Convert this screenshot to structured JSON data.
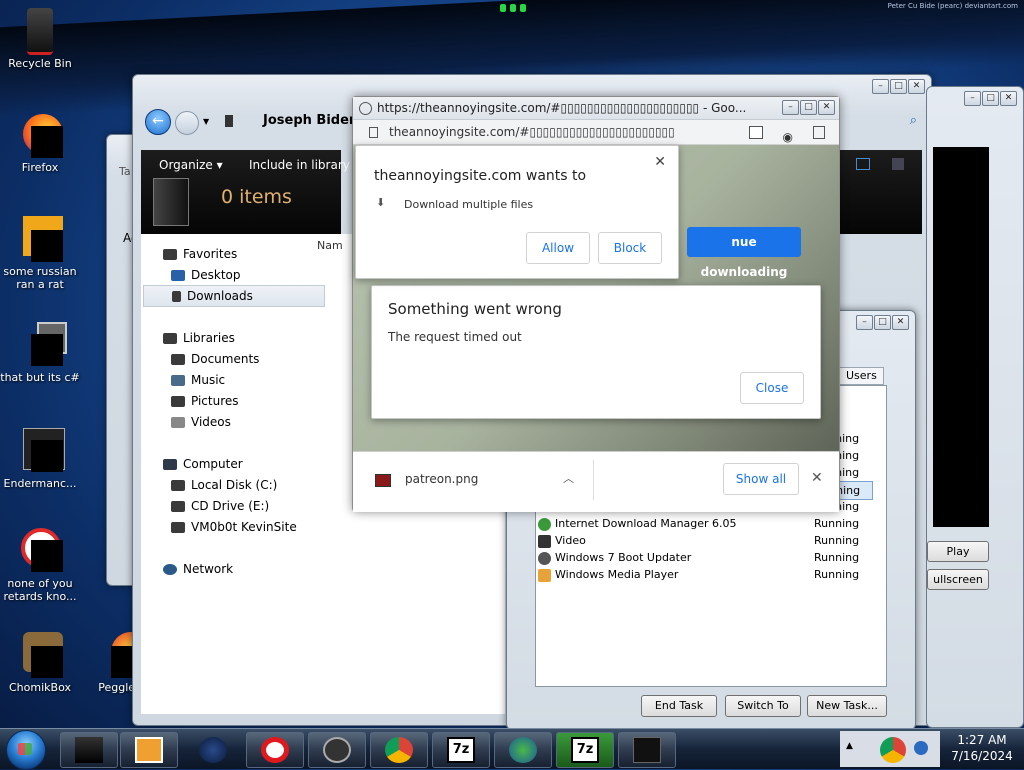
{
  "desktop": {
    "watermark": "Peter Cu Bide (pearc) deviantart.com",
    "icons": [
      {
        "label": "Recycle Bin"
      },
      {
        "label": "Firefox"
      },
      {
        "label": "some russian ran a rat"
      },
      {
        "label": "that but its c#"
      },
      {
        "label": "Endermanc..."
      },
      {
        "label": "none of you retards kno..."
      },
      {
        "label": "ChomikBox"
      },
      {
        "label": "Peggle De"
      }
    ]
  },
  "explorer": {
    "breadcrumb": "Joseph Biden",
    "organize_label": "Organize",
    "include_label": "Include in library",
    "items_count": "0 items",
    "name_col": "Nam",
    "tab_label": "Ta",
    "side_label": "Ac",
    "nav": {
      "favorites": "Favorites",
      "desktop": "Desktop",
      "downloads": "Downloads",
      "libraries": "Libraries",
      "documents": "Documents",
      "music": "Music",
      "pictures": "Pictures",
      "videos": "Videos",
      "computer": "Computer",
      "local_disk": "Local Disk (C:)",
      "cd_drive": "CD Drive (E:)",
      "vm": "VM0b0t KevinSite",
      "network": "Network"
    }
  },
  "chrome": {
    "title": "https://theannoyingsite.com/#▯▯▯▯▯▯▯▯▯▯▯▯▯▯▯▯▯▯▯▯▯ - Goo...",
    "url": "theannoyingsite.com/#▯▯▯▯▯▯▯▯▯▯▯▯▯▯▯▯▯▯▯▯▯▯",
    "permission": {
      "title": "theannoyingsite.com wants to",
      "request": "Download multiple files",
      "allow": "Allow",
      "block": "Block"
    },
    "continue_label": "nue downloading",
    "error": {
      "title": "Something went wrong",
      "message": "The request timed out",
      "close": "Close"
    },
    "download_bar": {
      "file": "patreon.png",
      "show_all": "Show all"
    }
  },
  "task_manager": {
    "users_tab": "Users",
    "status_col": "s",
    "rows": [
      {
        "name": "",
        "status": "Running"
      },
      {
        "name": "",
        "status": "Running"
      },
      {
        "name": "",
        "status": "Running"
      },
      {
        "name": "",
        "status": "Running"
      },
      {
        "name": "",
        "status": "Running"
      },
      {
        "name": "Internet Download Manager 6.05",
        "status": "Running"
      },
      {
        "name": "Video",
        "status": "Running"
      },
      {
        "name": "Windows 7 Boot Updater",
        "status": "Running"
      },
      {
        "name": "Windows Media Player",
        "status": "Running"
      }
    ],
    "end_task": "End Task",
    "switch_to": "Switch To",
    "new_task": "New Task..."
  },
  "media_player": {
    "play": "Play",
    "fullscreen": "ullscreen"
  },
  "taskbar": {
    "time": "1:27 AM",
    "date": "7/16/2024",
    "items": [
      {
        "icon": "explorer-icon"
      },
      {
        "icon": "media-player-icon"
      },
      {
        "icon": "globe-icon"
      },
      {
        "icon": "opera-icon"
      },
      {
        "icon": "bomb-icon"
      },
      {
        "icon": "chrome-icon"
      },
      {
        "icon": "7zip-icon"
      },
      {
        "icon": "idm-icon"
      },
      {
        "icon": "7zip-icon"
      },
      {
        "icon": "task-manager-icon"
      }
    ]
  },
  "colors": {
    "accent": "#1a73e8",
    "taskbar": "#16243a",
    "wallpaper": "#1a4f9a"
  }
}
